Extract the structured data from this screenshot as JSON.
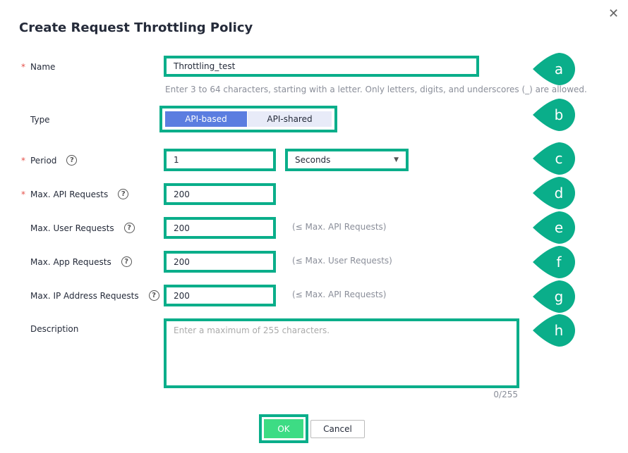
{
  "dialog": {
    "title": "Create Request Throttling Policy",
    "close_icon": "close-icon"
  },
  "colors": {
    "highlight": "#0aae8a",
    "primary": "#5b7de0",
    "ok": "#3ddc84",
    "required": "#e4514a"
  },
  "fields": {
    "name": {
      "label": "Name",
      "value": "Throttling_test",
      "hint": "Enter 3 to 64 characters, starting with a letter. Only letters, digits, and underscores (_) are allowed."
    },
    "type": {
      "label": "Type",
      "options": [
        "API-based",
        "API-shared"
      ],
      "selected": "API-based"
    },
    "period": {
      "label": "Period",
      "value": "1",
      "unit": "Seconds"
    },
    "max_api": {
      "label": "Max. API Requests",
      "value": "200"
    },
    "max_user": {
      "label": "Max. User Requests",
      "value": "200",
      "hint": "(≤ Max. API Requests)"
    },
    "max_app": {
      "label": "Max. App Requests",
      "value": "200",
      "hint": "(≤ Max. User Requests)"
    },
    "max_ip": {
      "label": "Max. IP Address Requests",
      "value": "200",
      "hint": "(≤ Max. API Requests)"
    },
    "description": {
      "label": "Description",
      "placeholder": "Enter a maximum of 255 characters.",
      "counter": "0/255"
    }
  },
  "required_mark": "*",
  "help_glyph": "?",
  "callouts": [
    "a",
    "b",
    "c",
    "d",
    "e",
    "f",
    "g",
    "h"
  ],
  "buttons": {
    "ok": "OK",
    "cancel": "Cancel"
  }
}
